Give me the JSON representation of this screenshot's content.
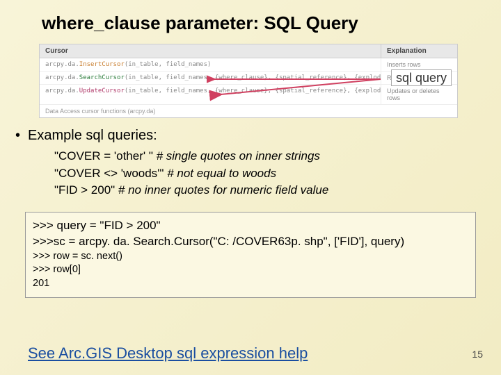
{
  "title": "where_clause parameter: SQL Query",
  "table": {
    "head_left": "Cursor",
    "head_right": "Explanation",
    "rows": [
      {
        "kw": "InsertCursor",
        "left_pre": "arcpy.da.",
        "left_post": "(in_table, field_names)",
        "right": "Inserts rows"
      },
      {
        "kw": "SearchCursor",
        "left_pre": "arcpy.da.",
        "left_post": "(in_table, field_names, {where_clause}, {spatial_reference}, {explode_to_points}, {sql_clause})",
        "right": "Read-only access"
      },
      {
        "kw": "UpdateCursor",
        "left_pre": "arcpy.da.",
        "left_post": "(in_table, field_names, {where_clause}, {spatial_reference}, {explode_to_points}, {sql_clause})",
        "right": "Updates or deletes rows"
      }
    ],
    "footer": "Data Access cursor functions (arcpy.da)"
  },
  "arrow_label": "sql query",
  "bullet": "Example sql queries:",
  "examples": [
    {
      "code": "\"COVER = 'other' \" ",
      "comment": "# single quotes on inner strings"
    },
    {
      "code": "\"COVER <> 'woods'\" ",
      "comment": "# not  equal to woods"
    },
    {
      "code": "\"FID > 200\" ",
      "comment": "# no inner quotes for numeric field value"
    }
  ],
  "codebox": {
    "l1": ">>> query = \"FID > 200\"",
    "l2": ">>>sc = arcpy. da. Search.Cursor(\"C: /COVER63p. shp\", ['FID'], query)",
    "l3": ">>> row = sc. next()",
    "l4": ">>> row[0]",
    "l5": "201"
  },
  "link": "See Arc.GIS Desktop sql expression help",
  "pagenum": "15"
}
